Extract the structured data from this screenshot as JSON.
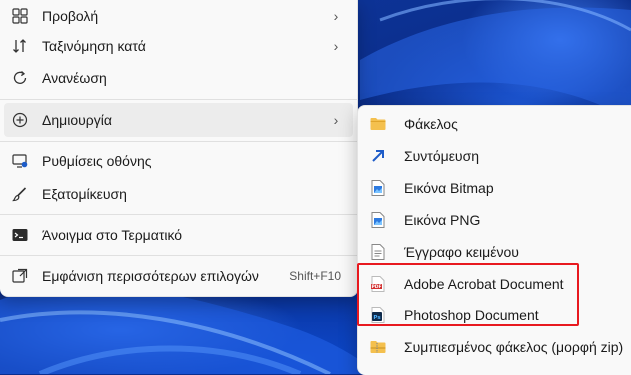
{
  "main_menu": {
    "items": [
      {
        "label": "Προβολή",
        "icon": "view-grid-icon",
        "has_submenu": true
      },
      {
        "label": "Ταξινόμηση κατά",
        "icon": "sort-arrows-icon",
        "has_submenu": true
      },
      {
        "label": "Ανανέωση",
        "icon": "refresh-icon",
        "has_submenu": false
      },
      {
        "label": "Δημιουργία",
        "icon": "plus-circle-icon",
        "has_submenu": true
      },
      {
        "label": "Ρυθμίσεις οθόνης",
        "icon": "display-settings-icon",
        "has_submenu": false
      },
      {
        "label": "Εξατομίκευση",
        "icon": "brush-icon",
        "has_submenu": false
      },
      {
        "label": "Άνοιγμα στο Τερματικό",
        "icon": "terminal-icon",
        "has_submenu": false
      },
      {
        "label": "Εμφάνιση περισσότερων επιλογών",
        "icon": "more-options-icon",
        "shortcut": "Shift+F10"
      }
    ]
  },
  "sub_menu": {
    "items": [
      {
        "label": "Φάκελος",
        "icon": "folder-icon"
      },
      {
        "label": "Συντόμευση",
        "icon": "shortcut-arrow-icon"
      },
      {
        "label": "Εικόνα Bitmap",
        "icon": "bitmap-image-icon"
      },
      {
        "label": "Εικόνα PNG",
        "icon": "png-image-icon"
      },
      {
        "label": "Έγγραφο κειμένου",
        "icon": "text-document-icon"
      },
      {
        "label": "Adobe Acrobat Document",
        "icon": "pdf-icon"
      },
      {
        "label": "Photoshop Document",
        "icon": "photoshop-icon"
      },
      {
        "label": "Συμπιεσμένος φάκελος (μορφή zip)",
        "icon": "zip-folder-icon"
      }
    ]
  },
  "icon_text": {
    "pdf": "PDF",
    "ps": "Ps"
  },
  "colors": {
    "highlight_border": "#e8191f",
    "folder": "#f4c04e",
    "shortcut_arrow": "#1e5cc8",
    "ps_bg": "#0f2a4a",
    "pdf_red": "#d32f2f"
  }
}
